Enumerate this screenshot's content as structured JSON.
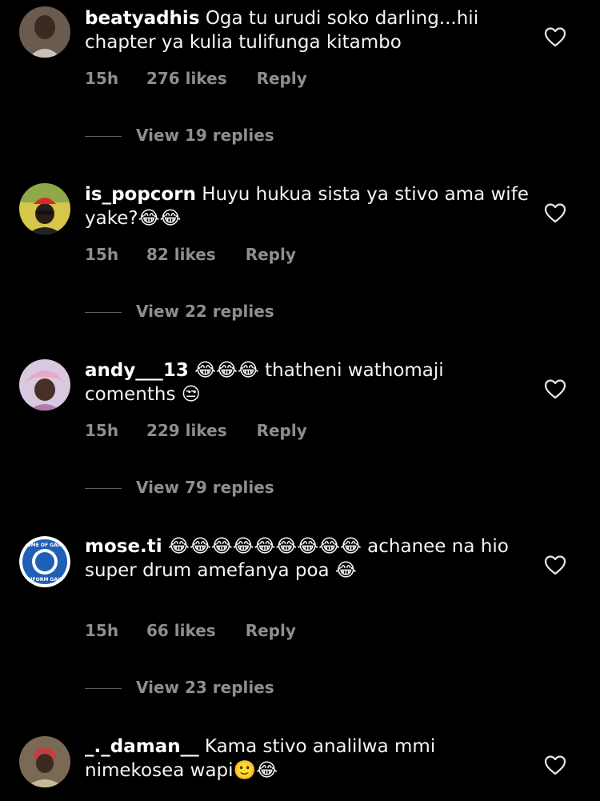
{
  "comments": [
    {
      "username": "beatyadhis",
      "text": "Oga tu urudi soko darling...hii chapter ya kulia tulifunga kitambo",
      "time": "15h",
      "likes": "276 likes",
      "reply": "Reply",
      "view_replies": "View 19 replies",
      "avatar_icon": "profile-photo-woman"
    },
    {
      "username": "is_popcorn",
      "text": "Huyu hukua sista ya stivo ama wife yake?😂😂",
      "time": "15h",
      "likes": "82 likes",
      "reply": "Reply",
      "view_replies": "View 22 replies",
      "avatar_icon": "profile-photo-red-cap"
    },
    {
      "username": "andy___13",
      "text": "😂😂😂 thatheni wathomaji comenths 😒",
      "time": "15h",
      "likes": "229 likes",
      "reply": "Reply",
      "view_replies": "View 79 replies",
      "avatar_icon": "profile-photo-pink"
    },
    {
      "username": "mose.ti",
      "text": "😂😂😂😂😂😂😂😂😂 achanee na hio super drum amefanya poa 😂",
      "time": "15h",
      "likes": "66 likes",
      "reply": "Reply",
      "view_replies": "View 23 replies",
      "avatar_icon": "home-of-gains-logo",
      "avatar_text_top": "HOME OF GAINS",
      "avatar_text_bottom": "UNIFORM GAINS"
    },
    {
      "username": "_._daman__",
      "text": "Kama stivo analilwa mmi nimekosea wapi🙂😂",
      "avatar_icon": "profile-photo-man"
    }
  ],
  "icons": {
    "like": "heart-outline-icon"
  },
  "colors": {
    "background": "#000000",
    "text": "#ffffff",
    "secondary": "#8e8e8e"
  }
}
